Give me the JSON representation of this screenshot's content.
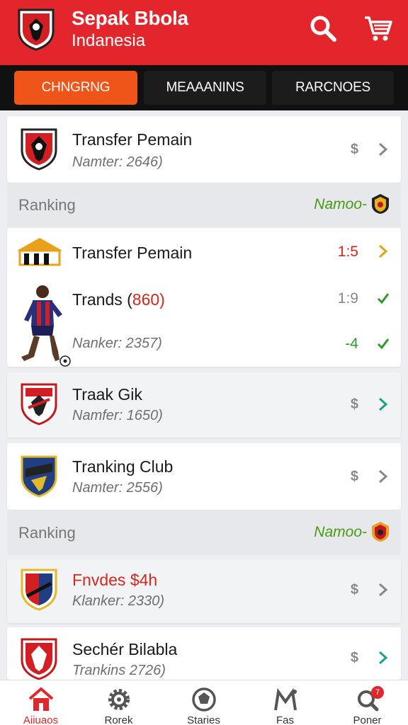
{
  "header": {
    "title": "Sepak Bbola",
    "subtitle": "Indanesia",
    "search_icon": "search-icon",
    "cart_icon": "cart-icon",
    "brand_color": "#e3262b"
  },
  "tabs": [
    {
      "label": "CHNGRNG",
      "active": true
    },
    {
      "label": "MEAAANINS",
      "active": false
    },
    {
      "label": "RARCNOES",
      "active": false
    }
  ],
  "cards": {
    "c1": {
      "title": "Transfer Pemain",
      "sub": "Namter: 2646)",
      "price": "$"
    },
    "ranking1": {
      "label": "Ranking",
      "name": "Namoo-"
    },
    "transfer": {
      "title": "Transfer Pemain",
      "score": "1:5"
    },
    "trands": {
      "title": "Trands (",
      "title_accent": "860)",
      "score": "1:9",
      "sub": "Nanker: 2357)",
      "score2": "-4"
    },
    "c3": {
      "title": "Traak Gik",
      "sub": "Namfer: 1650)",
      "price": "$"
    },
    "c4": {
      "title": "Tranking Club",
      "sub": "Namter: 2556)",
      "price": "$"
    },
    "ranking2": {
      "label": "Ranking",
      "name": "Namoo-"
    },
    "c5": {
      "title": "Fnvdes $4h",
      "sub": "Klanker: 2330)",
      "price": "$"
    },
    "c6": {
      "title": "Sechér Bilabla",
      "sub": "Trankins 2726)",
      "price": "$"
    }
  },
  "nav": [
    {
      "label": "Aiiuaos",
      "icon": "home-icon",
      "active": true
    },
    {
      "label": "Rorek",
      "icon": "gear-icon",
      "active": false
    },
    {
      "label": "Staries",
      "icon": "soccer-ball-icon",
      "active": false
    },
    {
      "label": "Fas",
      "icon": "tactics-icon",
      "active": false
    },
    {
      "label": "Poner",
      "icon": "search-notification-icon",
      "active": false,
      "badge": "7"
    }
  ]
}
